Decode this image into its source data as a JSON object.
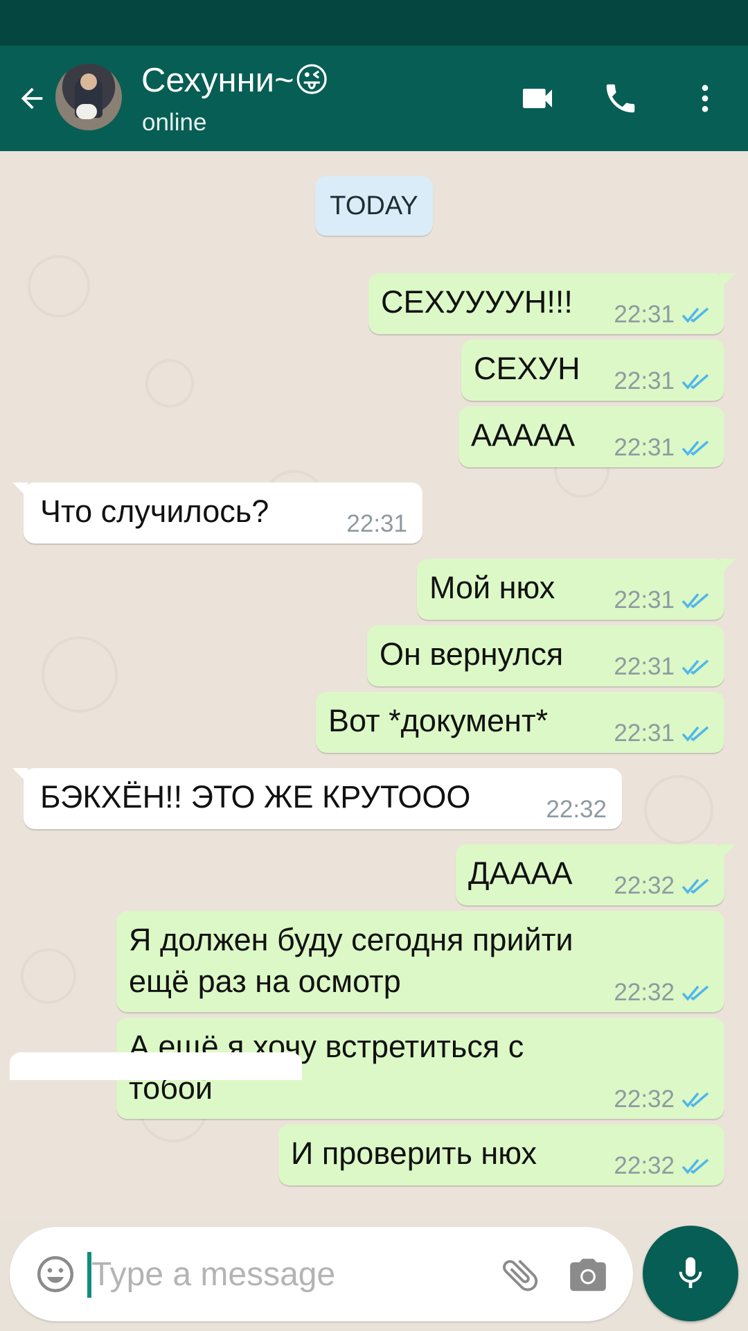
{
  "header": {
    "back_icon": "arrow-left-icon",
    "contact_name": "Сехунни~😜",
    "contact_status": "online",
    "video_icon": "video-call-icon",
    "call_icon": "phone-icon",
    "menu_icon": "more-vert-icon"
  },
  "chat": {
    "date_label": "TODAY",
    "messages": [
      {
        "dir": "out",
        "text": "СЕХУУУУН!!!",
        "time": "22:31",
        "status": "read"
      },
      {
        "dir": "out",
        "text": "СЕХУН",
        "time": "22:31",
        "status": "read"
      },
      {
        "dir": "out",
        "text": "ААААА",
        "time": "22:31",
        "status": "read"
      },
      {
        "dir": "in",
        "text": "Что случилось?",
        "time": "22:31"
      },
      {
        "dir": "out",
        "text": "Мой нюх",
        "time": "22:31",
        "status": "read"
      },
      {
        "dir": "out",
        "text": "Он вернулся",
        "time": "22:31",
        "status": "read"
      },
      {
        "dir": "out",
        "text": "Вот *документ*",
        "time": "22:31",
        "status": "read"
      },
      {
        "dir": "in",
        "text": "БЭКХЁН!! ЭТО ЖЕ КРУТООО",
        "time": "22:32"
      },
      {
        "dir": "out",
        "text": "ДАААА",
        "time": "22:32",
        "status": "read"
      },
      {
        "dir": "out",
        "text": "Я должен буду сегодня прийти ещё раз на осмотр",
        "time": "22:32",
        "status": "read"
      },
      {
        "dir": "out",
        "text": "А ещё я хочу встретиться с тобой",
        "time": "22:32",
        "status": "read"
      },
      {
        "dir": "out",
        "text": "И проверить нюх",
        "time": "22:32",
        "status": "read"
      }
    ]
  },
  "composer": {
    "placeholder": "Type a message",
    "emoji_icon": "emoji-icon",
    "attach_icon": "paperclip-icon",
    "camera_icon": "camera-icon",
    "mic_icon": "mic-icon"
  },
  "colors": {
    "header": "#075e54",
    "status_bar": "#054740",
    "outgoing_bubble": "#dcf8c6",
    "incoming_bubble": "#ffffff",
    "read_ticks": "#4fb6ec",
    "date_pill": "#d9ecf7"
  }
}
